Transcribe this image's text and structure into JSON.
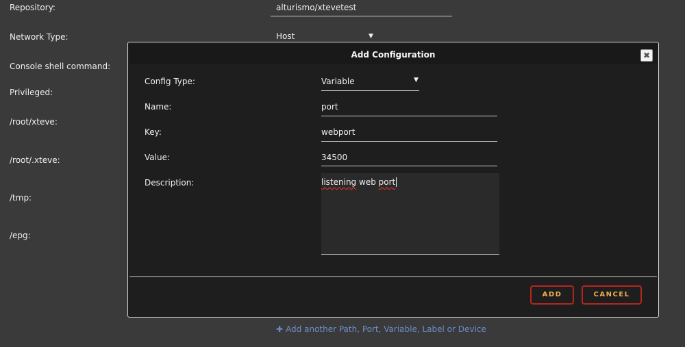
{
  "background": {
    "labels": {
      "repository": "Repository:",
      "network_type": "Network Type:",
      "console": "Console shell command:",
      "privileged": "Privileged:",
      "path_xteve": "/root/xteve:",
      "path_dot_xteve": "/root/.xteve:",
      "path_tmp": "/tmp:",
      "path_epg": "/epg:"
    },
    "repository_value": "alturismo/xtevetest",
    "network_type_value": "Host",
    "add_another_link": "Add another Path, Port, Variable, Label or Device"
  },
  "dialog": {
    "title": "Add Configuration",
    "close_glyph": "✖",
    "fields": {
      "config_type_label": "Config Type:",
      "config_type_value": "Variable",
      "name_label": "Name:",
      "name_value": "port",
      "key_label": "Key:",
      "key_value": "webport",
      "value_label": "Value:",
      "value_value": "34500",
      "description_label": "Description:",
      "description_word1": "listening",
      "description_word2": "web",
      "description_word3": "port"
    },
    "buttons": {
      "add": "ADD",
      "cancel": "CANCEL"
    }
  },
  "colors": {
    "accent_button_border": "#b3261e",
    "accent_button_text": "#f0ad4e",
    "link_color": "#6d8cc5"
  },
  "icons": {
    "close": "close-icon",
    "dropdown": "caret-down-icon",
    "plus": "plus-icon"
  }
}
